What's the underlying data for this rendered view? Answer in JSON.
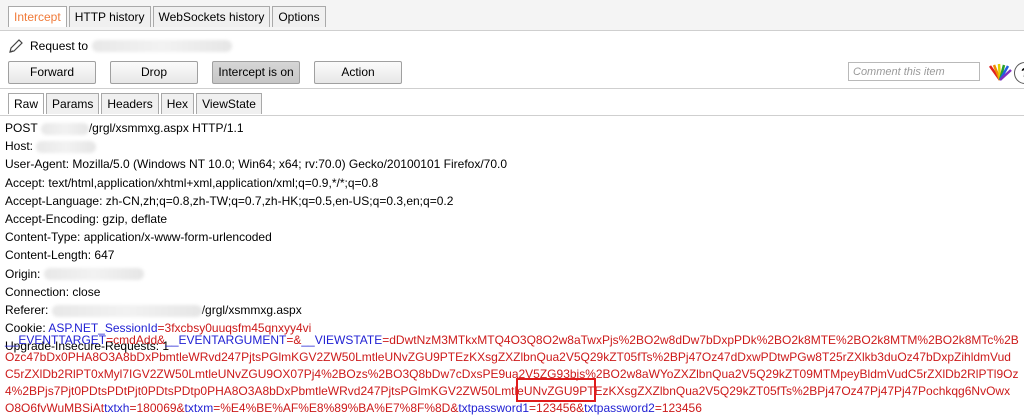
{
  "tabs": {
    "top": [
      "Intercept",
      "HTTP history",
      "WebSockets history",
      "Options"
    ],
    "active_top": "Intercept",
    "message": [
      "Raw",
      "Params",
      "Headers",
      "Hex",
      "ViewState"
    ],
    "active_message": "Raw"
  },
  "request": {
    "label": "Request to"
  },
  "buttons": {
    "forward": "Forward",
    "drop": "Drop",
    "intercept": "Intercept is on",
    "action": "Action"
  },
  "comment_placeholder": "Comment this item",
  "help": "?",
  "headers": {
    "post_path": "/grgl/xsmmxg.aspx HTTP/1.1",
    "post_method": "POST",
    "host": "Host:",
    "user_agent": "User-Agent: Mozilla/5.0 (Windows NT 10.0; Win64; x64; rv:70.0) Gecko/20100101 Firefox/70.0",
    "accept": "Accept: text/html,application/xhtml+xml,application/xml;q=0.9,*/*;q=0.8",
    "accept_language": "Accept-Language: zh-CN,zh;q=0.8,zh-TW;q=0.7,zh-HK;q=0.5,en-US;q=0.3,en;q=0.2",
    "accept_encoding": "Accept-Encoding: gzip, deflate",
    "content_type": "Content-Type: application/x-www-form-urlencoded",
    "content_length": "Content-Length: 647",
    "origin": "Origin:",
    "connection": "Connection: close",
    "referer_label": "Referer:",
    "referer_path": "/grgl/xsmmxg.aspx",
    "cookie_label": "Cookie: ",
    "cookie_name": "ASP.NET_SessionId",
    "cookie_value": "=3fxcbsy0uuqsfm45qnxyy4vi",
    "upgrade": "Upgrade-Insecure-Requests: 1"
  },
  "body": {
    "p1": "__EVENTTARGET",
    "v1": "=cmdAdd&",
    "p2": "__EVENTARGUMENT",
    "v2": "=&",
    "p3": "__VIEWSTATE",
    "v3": "=dDwtNzM3MTkxMTQ4O3Q8O2w8aTwxPjs%2BO2w8dDw7bDxpPDk%2BO2k8MTE%2BO2k8MTM%2BO2k8MTc%2BOzc47bDx0PHA8O3A8bDxPbmtleWRvd247PjtsPGlmKGV2ZW50LmtleUNvZGU9PTEzKXsgZXZlbnQua2V5Q29kZT05fTs%2BPj47Oz47dDxwPDtwPGw8T25rZXlkb3duOz47bDxpZihldmVudC5rZXlDb2RlPT0xMyl7IGV2ZW50LmtleUNvZGU9OX07Pj4%2BOzs%2BO3Q8bDw7cDxsPE9ua2V5ZG93bjs%2BO2w8aWYoZXZlbnQua2V5Q29kZT09MTMpeyBldmVudC5rZXlDb2RlPTl9Oz4%2BPjs7Pjt0PDtsPDtPjt0PDtsPDtp0PHA8O3A8bDxPbmtleWRvd247PjtsPGlmKGV2ZW50LmtleUNvZGU9PTEzKXsgZXZlbnQua2V5Q29kZT05fTs%2BPj47Oz47Pj47Pj47Pochkqg6NvOwxO8O6fvWuMBSiAt",
    "p4": "txtxh",
    "v4": "=180069&",
    "p5": "txtxm",
    "v5": "=%E4%BE%AF%E8%89%BA%E7%8F%8D&",
    "p6": "txtpassword1",
    "v6": "=123456&",
    "p7": "txtpassword2",
    "v7": "=123456"
  }
}
